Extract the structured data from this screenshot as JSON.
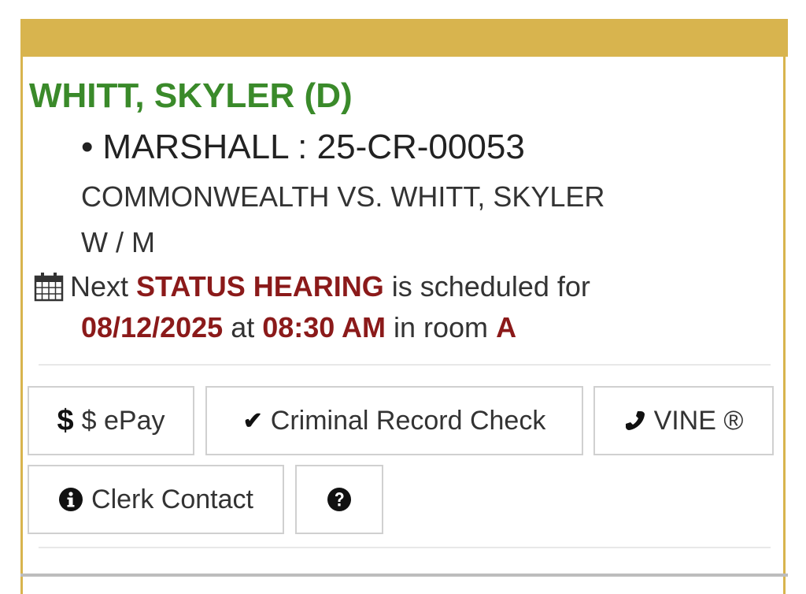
{
  "defendant": {
    "name": "WHITT, SKYLER (D)"
  },
  "case": {
    "bullet": "•",
    "county_case": "MARSHALL : 25-CR-00053",
    "style": "COMMONWEALTH VS. WHITT, SKYLER",
    "race_sex": "W / M"
  },
  "hearing": {
    "prefix": "Next",
    "type": "STATUS HEARING",
    "middle": "is scheduled for",
    "date": "08/12/2025",
    "at": "at",
    "time": "08:30 AM",
    "in_room": "in room",
    "room": "A",
    "icon": "calendar-icon"
  },
  "buttons": {
    "epay": {
      "icon_glyph": "$",
      "label": "$ ePay",
      "icon": "dollar-icon"
    },
    "record_check": {
      "icon_glyph": "✔",
      "label": "Criminal Record Check",
      "icon": "check-icon"
    },
    "vine": {
      "label": "VINE ®",
      "icon": "phone-icon"
    },
    "clerk": {
      "label": "Clerk Contact",
      "icon": "info-icon"
    },
    "help": {
      "icon": "question-icon"
    }
  },
  "colors": {
    "header": "#d8b44e",
    "name_green": "#3a8a2a",
    "emphasis_red": "#8b1a1a"
  }
}
